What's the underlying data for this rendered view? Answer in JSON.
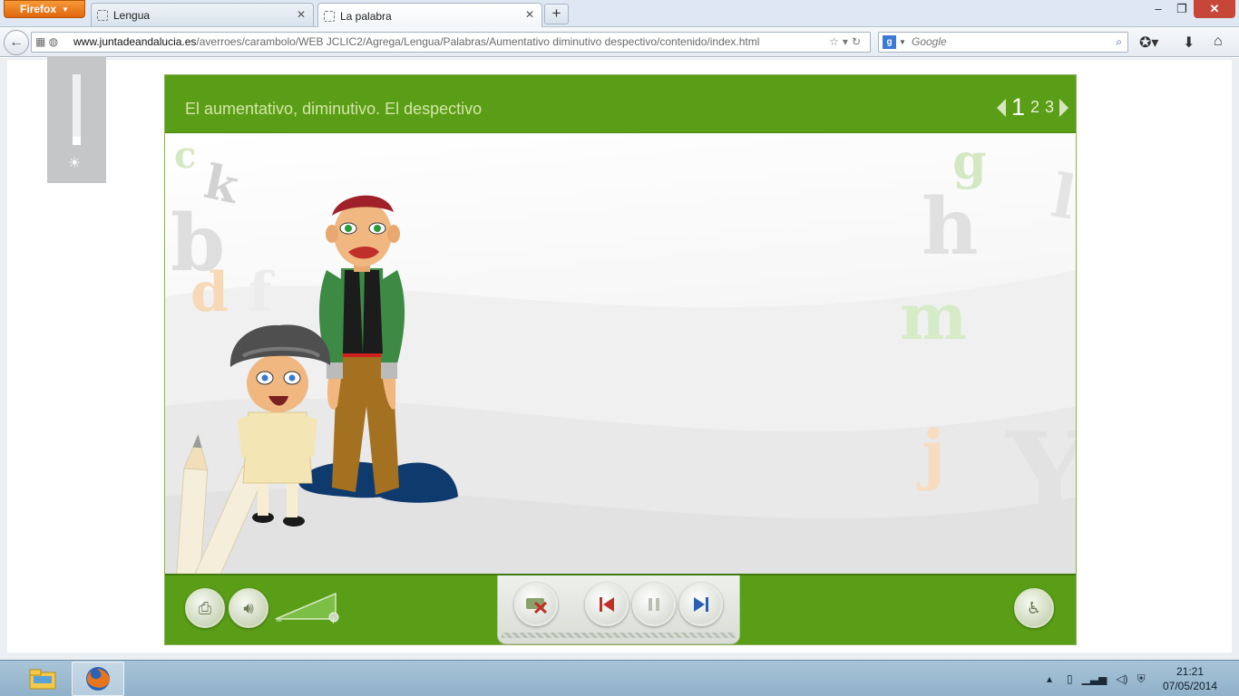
{
  "browser": {
    "menu_button": "Firefox",
    "tabs": [
      {
        "label": "Lengua",
        "active": false
      },
      {
        "label": "La palabra",
        "active": true
      }
    ],
    "new_tab_label": "+",
    "url_domain": "www.juntadeandalucia.es",
    "url_path": "/averroes/carambolo/WEB JCLIC2/Agrega/Lengua/Palabras/Aumentativo diminutivo despectivo/contenido/index.html",
    "search_engine_icon": "g",
    "search_placeholder": "Google"
  },
  "app": {
    "title": "El aumentativo, diminutivo. El despectivo",
    "pages": [
      "1",
      "2",
      "3"
    ],
    "current_page": "1",
    "background_letters": [
      "c",
      "k",
      "b",
      "d",
      "f",
      "g",
      "h",
      "l",
      "m",
      "j",
      "Y"
    ],
    "volume_level": 1.0,
    "colors": {
      "header_green": "#5a9e17",
      "title_text": "#d4e6a6"
    }
  },
  "taskbar": {
    "time": "21:21",
    "date": "07/05/2014"
  }
}
